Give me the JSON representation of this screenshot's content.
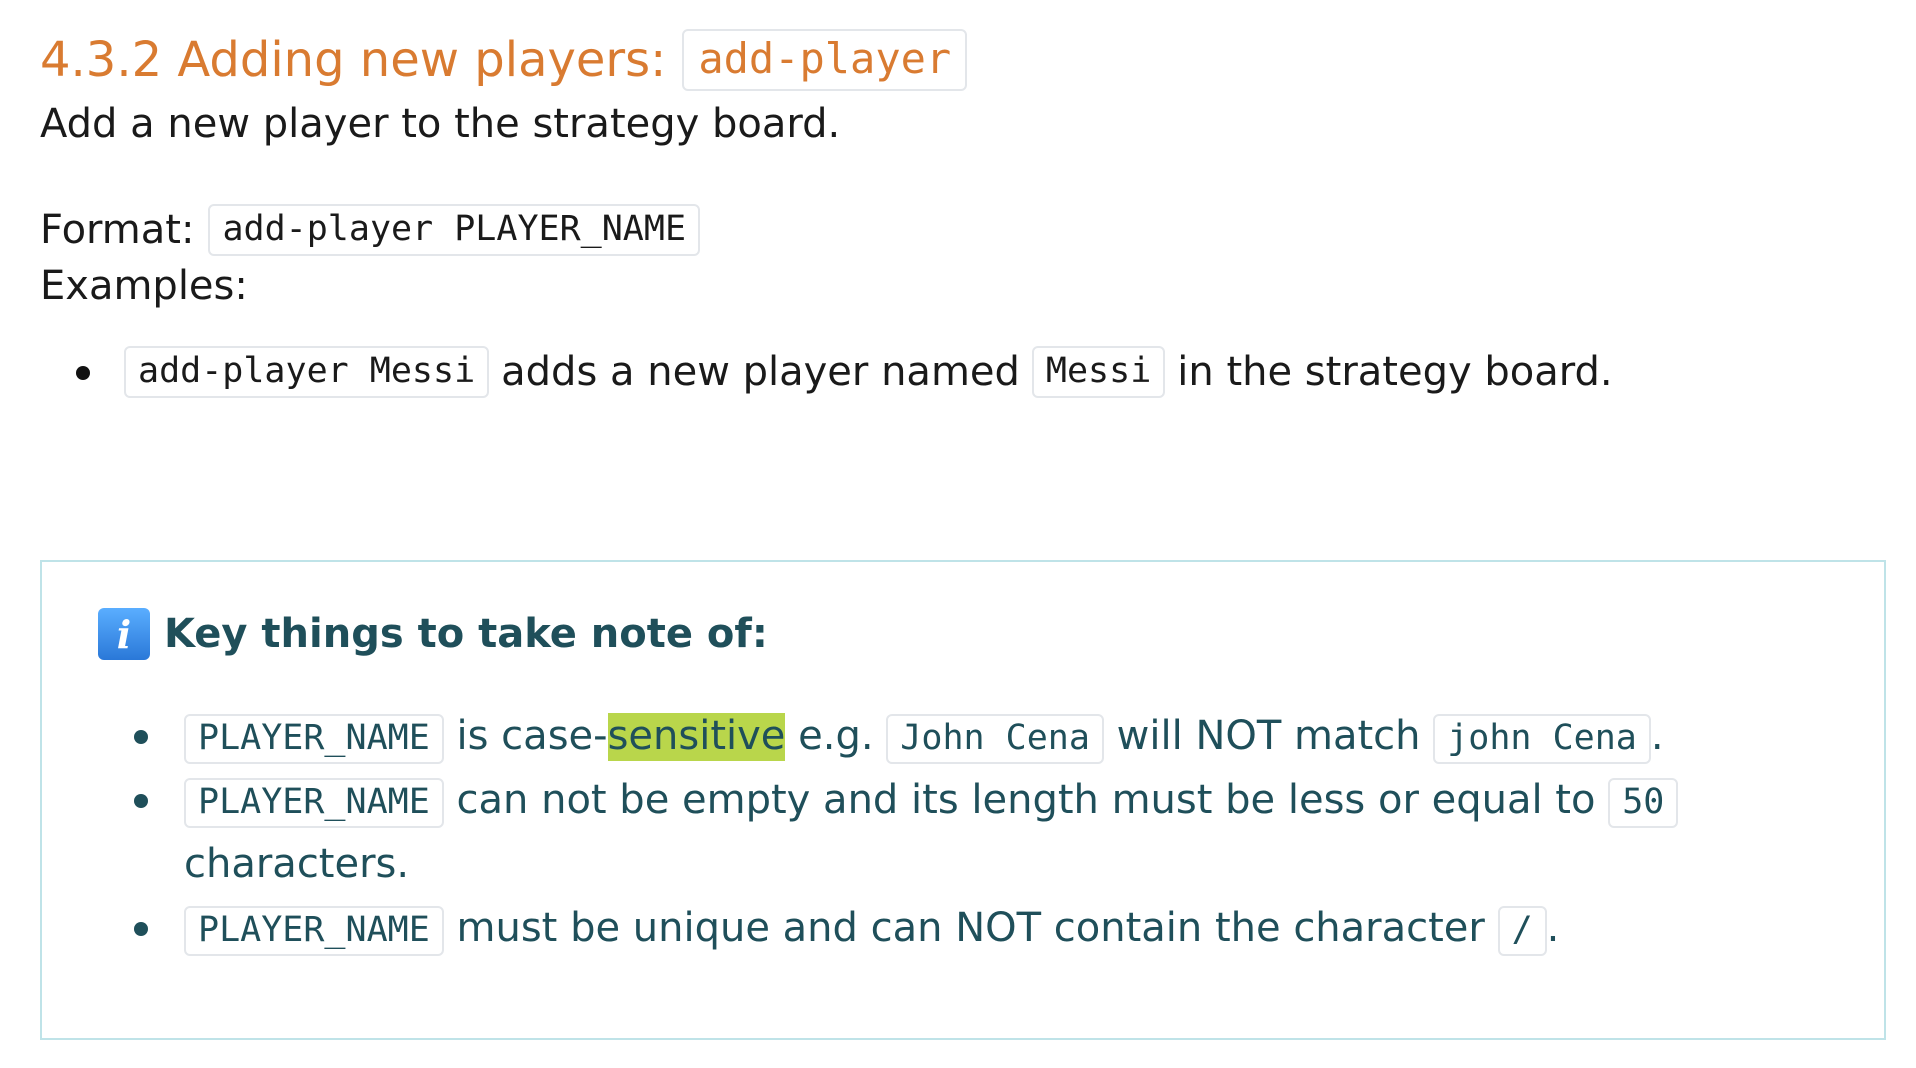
{
  "heading": {
    "prefix": "4.3.2 Adding new players:",
    "command": "add-player"
  },
  "description": "Add a new player to the strategy board.",
  "format": {
    "label": "Format:",
    "code": "add-player PLAYER_NAME"
  },
  "examples": {
    "label": "Examples:",
    "items": [
      {
        "code": "add-player Messi",
        "text1": "adds a new player named",
        "code2": "Messi",
        "text2": "in the strategy board."
      }
    ]
  },
  "note": {
    "icon": "info-icon",
    "heading": "Key things to take note of:",
    "item1": {
      "code": "PLAYER_NAME",
      "text_a": "is case-",
      "highlight": "sensitive",
      "text_b": "e.g.",
      "code2": "John Cena",
      "text_c": "will NOT match",
      "code3": "john Cena",
      "text_d": "."
    },
    "item2": {
      "code": "PLAYER_NAME",
      "text_a": "can not be empty and its length must be less or equal to",
      "code2": "50",
      "text_b": "characters."
    },
    "item3": {
      "code": "PLAYER_NAME",
      "text_a": "must be unique and can NOT contain the character",
      "code2": "/",
      "text_b": "."
    }
  }
}
